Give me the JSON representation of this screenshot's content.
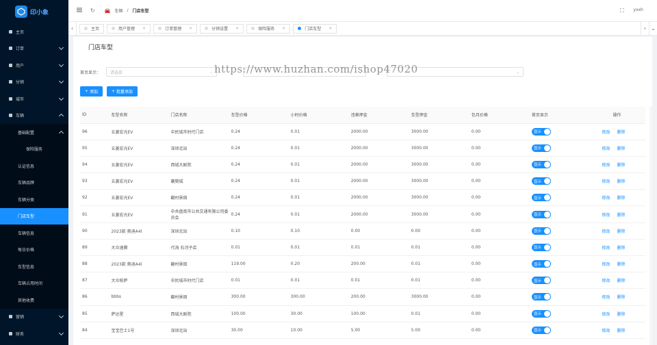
{
  "app": {
    "logo_text": "印小象"
  },
  "sidebar": {
    "items": [
      {
        "label": "主页",
        "level": 0,
        "icon": "home-icon",
        "chev": ""
      },
      {
        "label": "订单",
        "level": 0,
        "icon": "cart-icon",
        "chev": "down"
      },
      {
        "label": "用户",
        "level": 0,
        "icon": "user-icon",
        "chev": "down"
      },
      {
        "label": "分销",
        "level": 0,
        "icon": "share-icon",
        "chev": "down"
      },
      {
        "label": "城市",
        "level": 0,
        "icon": "location-icon",
        "chev": "down"
      },
      {
        "label": "车辆",
        "level": 0,
        "icon": "car-icon",
        "chev": "up"
      },
      {
        "label": "基础配置",
        "level": 1,
        "icon": "",
        "chev": "up"
      },
      {
        "label": "保险服务",
        "level": 2,
        "icon": "",
        "chev": ""
      },
      {
        "label": "认证信息",
        "level": 1,
        "icon": "",
        "chev": ""
      },
      {
        "label": "车辆品牌",
        "level": 1,
        "icon": "",
        "chev": ""
      },
      {
        "label": "车辆分类",
        "level": 1,
        "icon": "",
        "chev": ""
      },
      {
        "label": "门店车型",
        "level": 1,
        "icon": "",
        "chev": "",
        "active": true
      },
      {
        "label": "车辆信息",
        "level": 1,
        "icon": "",
        "chev": ""
      },
      {
        "label": "每日价格",
        "level": 1,
        "icon": "",
        "chev": ""
      },
      {
        "label": "车型信息",
        "level": 1,
        "icon": "",
        "chev": ""
      },
      {
        "label": "车辆占用时间",
        "level": 1,
        "icon": "",
        "chev": ""
      },
      {
        "label": "其他收费",
        "level": 1,
        "icon": "",
        "chev": ""
      },
      {
        "label": "营销",
        "level": 0,
        "icon": "marketing-icon",
        "chev": "down"
      },
      {
        "label": "财务",
        "level": 0,
        "icon": "finance-icon",
        "chev": "down"
      }
    ]
  },
  "header": {
    "breadcrumb": [
      "车辆",
      "门店车型"
    ],
    "user": "yxxh"
  },
  "tabs": [
    {
      "label": "主页",
      "active": false
    },
    {
      "label": "用户管理",
      "active": false
    },
    {
      "label": "订单管理",
      "active": false
    },
    {
      "label": "分销设置",
      "active": false
    },
    {
      "label": "保险服务",
      "active": false
    },
    {
      "label": "门店车型",
      "active": true
    }
  ],
  "page": {
    "title": "门店车型",
    "filter_label": "首页显示：",
    "filter_placeholder": "请选择",
    "add_label": "添加",
    "batch_add_label": "批量添加"
  },
  "watermark": "https://www.huzhan.com/ishop47020",
  "table": {
    "headers": [
      "ID",
      "车型名称",
      "门店名称",
      "车型价格",
      "小时价格",
      "违章押金",
      "车型押金",
      "包月价格",
      "首页显示",
      "操作"
    ],
    "switch_label": "显示",
    "edit_label": "修改",
    "delete_label": "删除",
    "rows": [
      [
        "96",
        "五菱宏光EV",
        "中民城市时代门店",
        "0.24",
        "0.01",
        "2000.00",
        "3000.00",
        "0.00"
      ],
      [
        "95",
        "五菱宏光EV",
        "深圳北站",
        "0.24",
        "0.01",
        "2000.00",
        "3000.00",
        "0.00"
      ],
      [
        "94",
        "五菱宏光EV",
        "西城大剧院",
        "0.24",
        "0.01",
        "2000.00",
        "3000.00",
        "0.00"
      ],
      [
        "93",
        "五菱宏光EV",
        "襄樊城",
        "0.24",
        "0.01",
        "2000.00",
        "3000.00",
        "0.00"
      ],
      [
        "92",
        "五菱宏光EV",
        "翻村景田",
        "0.24",
        "0.01",
        "2000.00",
        "3000.00",
        "0.00"
      ],
      [
        "91",
        "五菱宏光EV",
        "中共盘南市公共交通有限公司委员会",
        "0.24",
        "0.01",
        "2000.00",
        "3000.00",
        "0.00"
      ],
      [
        "90",
        "2023款 奥迪A4l",
        "深圳北站",
        "0.10",
        "0.10",
        "0.00",
        "0.00",
        "0.00"
      ],
      [
        "89",
        "大众速腾",
        "代海 石河子店",
        "0.01",
        "0.01",
        "0.01",
        "0.01",
        "0.00"
      ],
      [
        "88",
        "2023款 奥迪A4l",
        "翻村景田",
        "119.00",
        "0.20",
        "200.00",
        "0.01",
        "0.00"
      ],
      [
        "87",
        "大众帕萨",
        "中民城市时代门店",
        "0.01",
        "0.01",
        "0.01",
        "0.01",
        "0.00"
      ],
      [
        "86",
        "bbbs",
        "翻村景田",
        "300.00",
        "300.00",
        "200.00",
        "3000.00",
        "0.00"
      ],
      [
        "85",
        "萨达星",
        "西城大剧院",
        "100.00",
        "30.00",
        "100.00",
        "0.01",
        "0.00"
      ],
      [
        "84",
        "宝宝巴士1号",
        "深圳北站",
        "30.00",
        "10.00",
        "5.00",
        "5.00",
        "0.00"
      ]
    ]
  }
}
